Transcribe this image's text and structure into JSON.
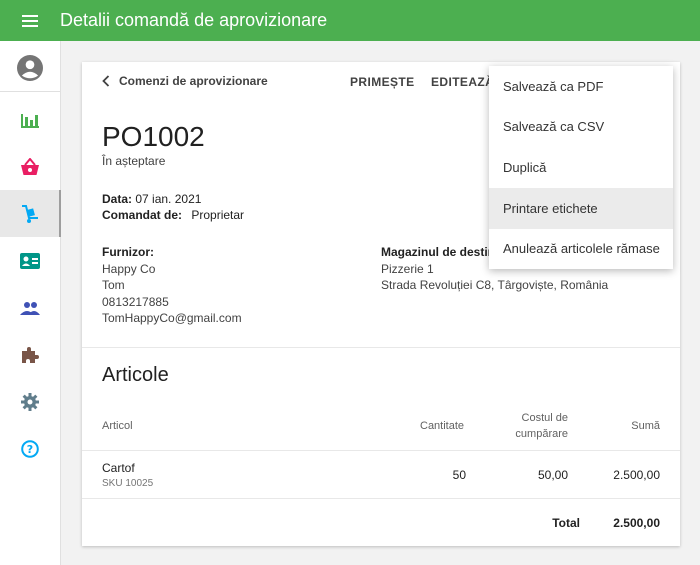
{
  "app": {
    "title": "Detalii comandă de aprovizionare"
  },
  "icons": {
    "menu": "hamburger-menu-icon",
    "account": "account-circle-icon",
    "reports": "bar-chart-icon",
    "sales": "basket-icon",
    "purchases": "hand-truck-icon",
    "customers": "id-card-icon",
    "employees": "people-icon",
    "integrations": "puzzle-icon",
    "settings": "gear-icon",
    "help": "help-circle-icon",
    "back": "chevron-left-icon"
  },
  "colors": {
    "topbar": "#4caf50",
    "reports": "#4caf50",
    "sales": "#e91e63",
    "purchases": "#03a9f4",
    "customers": "#009688",
    "employees": "#3f51b5",
    "integrations": "#795548",
    "settings": "#607d8b",
    "help": "#03a9f4"
  },
  "header": {
    "back_label": "Comenzi de aprovizionare",
    "receive_label": "PRIMEȘTE",
    "edit_label": "EDITEAZĂ"
  },
  "order": {
    "number": "PO1002",
    "status": "În așteptare",
    "date_label": "Data:",
    "date_value": "07 ian. 2021",
    "ordered_by_label": "Comandat de:",
    "ordered_by_value": "Proprietar"
  },
  "supplier": {
    "label": "Furnizor:",
    "name": "Happy Co",
    "contact": "Tom",
    "phone": "0813217885",
    "email": "TomHappyCo@gmail.com"
  },
  "destination": {
    "label": "Magazinul de destin",
    "store": "Pizzerie 1",
    "address": "Strada Revoluției C8, Târgoviște, România"
  },
  "items_section": {
    "title": "Articole",
    "columns": {
      "item": "Articol",
      "quantity": "Cantitate",
      "cost_line1": "Costul de",
      "cost_line2": "cumpărare",
      "amount": "Sumă"
    },
    "rows": [
      {
        "name": "Cartof",
        "sku": "SKU 10025",
        "quantity": "50",
        "cost": "50,00",
        "amount": "2.500,00"
      }
    ],
    "total_label": "Total",
    "total_value": "2.500,00"
  },
  "dropdown": {
    "items": [
      "Salvează ca PDF",
      "Salvează ca CSV",
      "Duplică",
      "Printare etichete",
      "Anulează articolele rămase"
    ]
  }
}
